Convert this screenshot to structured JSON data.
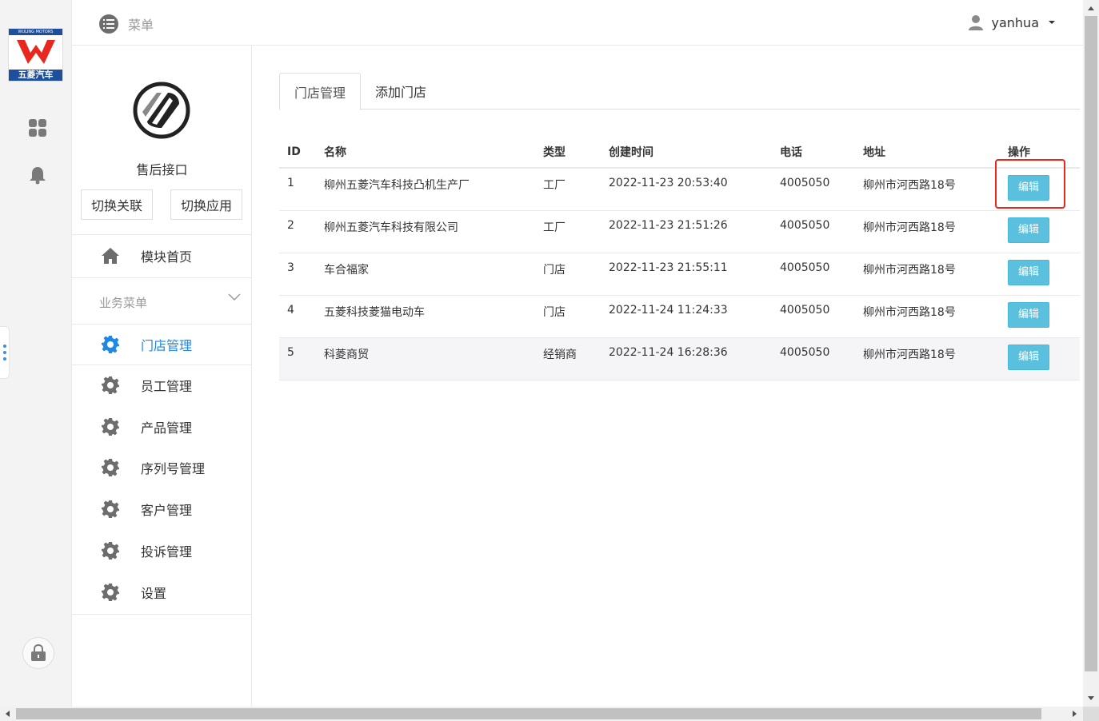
{
  "brand": {
    "logo_top_text": "WULING MOTORS",
    "logo_bottom_text": "五菱汽车",
    "colors": {
      "blue": "#1d4f9c",
      "red": "#e8271e"
    }
  },
  "rail": {
    "icons": [
      "apps-grid-icon",
      "bell-icon",
      "lock-icon"
    ]
  },
  "header": {
    "menu_label": "菜单",
    "username": "yanhua"
  },
  "sidebar": {
    "app_name": "售后接口",
    "switch_link_label": "切换关联",
    "switch_app_label": "切换应用",
    "home_label": "模块首页",
    "section_label": "业务菜单",
    "items": [
      {
        "label": "门店管理",
        "active": true
      },
      {
        "label": "员工管理",
        "active": false
      },
      {
        "label": "产品管理",
        "active": false
      },
      {
        "label": "序列号管理",
        "active": false
      },
      {
        "label": "客户管理",
        "active": false
      },
      {
        "label": "投诉管理",
        "active": false
      },
      {
        "label": "设置",
        "active": false
      }
    ],
    "accent_color": "#1e88e5"
  },
  "main": {
    "tabs": [
      {
        "label": "门店管理",
        "active": true
      },
      {
        "label": "添加门店",
        "active": false
      }
    ],
    "table": {
      "headers": [
        "ID",
        "名称",
        "类型",
        "创建时间",
        "电话",
        "地址",
        "操作"
      ],
      "rows": [
        {
          "id": "1",
          "name": "柳州五菱汽车科技凸机生产厂",
          "type": "工厂",
          "created": "2022-11-23 20:53:40",
          "phone": "4005050",
          "address": "柳州市河西路18号",
          "action": "编辑"
        },
        {
          "id": "2",
          "name": "柳州五菱汽车科技有限公司",
          "type": "工厂",
          "created": "2022-11-23 21:51:26",
          "phone": "4005050",
          "address": "柳州市河西路18号",
          "action": "编辑"
        },
        {
          "id": "3",
          "name": "车合福家",
          "type": "门店",
          "created": "2022-11-23 21:55:11",
          "phone": "4005050",
          "address": "柳州市河西路18号",
          "action": "编辑"
        },
        {
          "id": "4",
          "name": "五菱科技菱猫电动车",
          "type": "门店",
          "created": "2022-11-24 11:24:33",
          "phone": "4005050",
          "address": "柳州市河西路18号",
          "action": "编辑"
        },
        {
          "id": "5",
          "name": "科菱商贸",
          "type": "经销商",
          "created": "2022-11-24 16:28:36",
          "phone": "4005050",
          "address": "柳州市河西路18号",
          "action": "编辑"
        }
      ],
      "button_color": "#5bc0de"
    }
  }
}
